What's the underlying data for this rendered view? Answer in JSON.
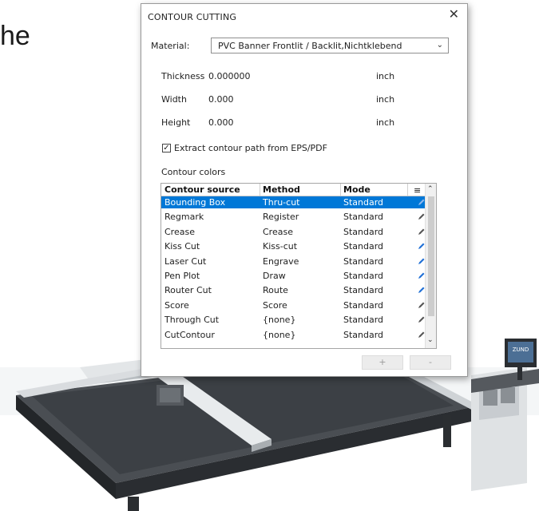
{
  "slide": {
    "text": "he"
  },
  "dialog": {
    "title": "CONTOUR CUTTING",
    "close": "✕",
    "material_label": "Material:",
    "material_value": "PVC Banner Frontlit / Backlit,Nichtklebend",
    "thickness_label": "Thickness",
    "thickness_value": "0.000000",
    "thickness_unit": "inch",
    "width_label": "Width",
    "width_value": "0.000",
    "width_unit": "inch",
    "height_label": "Height",
    "height_value": "0.000",
    "height_unit": "inch",
    "extract_checked": true,
    "extract_label": "Extract contour path from EPS/PDF",
    "contour_colors_label": "Contour colors",
    "table": {
      "headers": [
        "Contour source",
        "Method",
        "Mode",
        "≡"
      ],
      "rows": [
        {
          "source": "Bounding Box",
          "method": "Thru-cut",
          "mode": "Standard",
          "selected": true,
          "pen_color": "#8fb8ee"
        },
        {
          "source": "Regmark",
          "method": "Register",
          "mode": "Standard",
          "selected": false,
          "pen_color": "#555555"
        },
        {
          "source": "Crease",
          "method": "Crease",
          "mode": "Standard",
          "selected": false,
          "pen_color": "#555555"
        },
        {
          "source": "Kiss Cut",
          "method": "Kiss-cut",
          "mode": "Standard",
          "selected": false,
          "pen_color": "#1f6fd6"
        },
        {
          "source": "Laser Cut",
          "method": "Engrave",
          "mode": "Standard",
          "selected": false,
          "pen_color": "#1f6fd6"
        },
        {
          "source": "Pen Plot",
          "method": "Draw",
          "mode": "Standard",
          "selected": false,
          "pen_color": "#1f6fd6"
        },
        {
          "source": "Router Cut",
          "method": "Route",
          "mode": "Standard",
          "selected": false,
          "pen_color": "#1f6fd6"
        },
        {
          "source": "Score",
          "method": "Score",
          "mode": "Standard",
          "selected": false,
          "pen_color": "#555555"
        },
        {
          "source": "Through Cut",
          "method": "{none}",
          "mode": "Standard",
          "selected": false,
          "pen_color": "#555555"
        },
        {
          "source": "CutContour",
          "method": "{none}",
          "mode": "Standard",
          "selected": false,
          "pen_color": "#555555"
        }
      ]
    },
    "add_label": "+",
    "remove_label": "-",
    "selection_color": "#0078d7"
  },
  "machine": {
    "screen_logo": "ZUND"
  }
}
